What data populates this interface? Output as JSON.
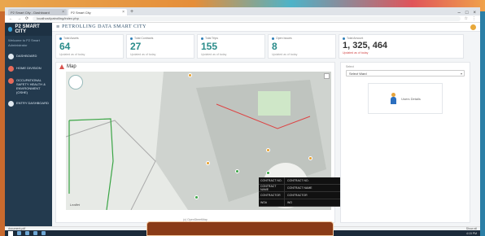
{
  "browser": {
    "tabs": [
      {
        "label": "P2 Smart City - Dashboard"
      },
      {
        "label": "P2 Smart City"
      }
    ],
    "url": "localhost/patrolling/index.php"
  },
  "app": {
    "brand": "P2 SMART CITY",
    "title": "PETROLLING DATA SMART CITY",
    "user_line1": "Welcome to P2 Smart",
    "user_line2": "Administrator",
    "nav": [
      {
        "label": "DASHBOARD",
        "icon": "dashboard-icon"
      },
      {
        "label": "HOME DIVISION",
        "icon": "home-icon"
      },
      {
        "label": "OCCUPATIONAL SAFETY HEALTH & ENVIRONMENT (OSHE)",
        "icon": "safety-icon"
      },
      {
        "label": "ENTRY DASHBOARD",
        "icon": "entry-icon"
      }
    ]
  },
  "stats": [
    {
      "label": "Total Assets",
      "value": "64",
      "sub": "Updated as of today"
    },
    {
      "label": "Total Contracts",
      "value": "27",
      "sub": "Updated as of today"
    },
    {
      "label": "Total Trips",
      "value": "155",
      "sub": "Updated as of today"
    },
    {
      "label": "Open Issues",
      "value": "8",
      "sub": "Updated as of today"
    },
    {
      "label": "Total Amount",
      "value": "1, 325, 464",
      "sub": "Updated as of today"
    }
  ],
  "map": {
    "title": "Map",
    "attribution": "Leaflet",
    "caption": "(c) OpenStreetMap",
    "popup": [
      {
        "key": "CONTRACT NO.",
        "value": "CONTRACT NO."
      },
      {
        "key": "CONTRACT NAME",
        "value": "CONTRACT NAME"
      },
      {
        "key": "CONTRACTOR",
        "value": "CONTRACTOR"
      },
      {
        "key": "WO#",
        "value": "WO"
      }
    ]
  },
  "side": {
    "label": "Select",
    "select_value": "Select Ward",
    "user_label": "Users Details"
  },
  "download_bar": {
    "file": "document.pdf",
    "show_all": "Show all"
  },
  "taskbar": {
    "clock": "4:15 PM"
  },
  "colors": {
    "sidebar": "#233a4e",
    "stat_value": "#2a8c8a",
    "popup_bg": "#111111"
  }
}
